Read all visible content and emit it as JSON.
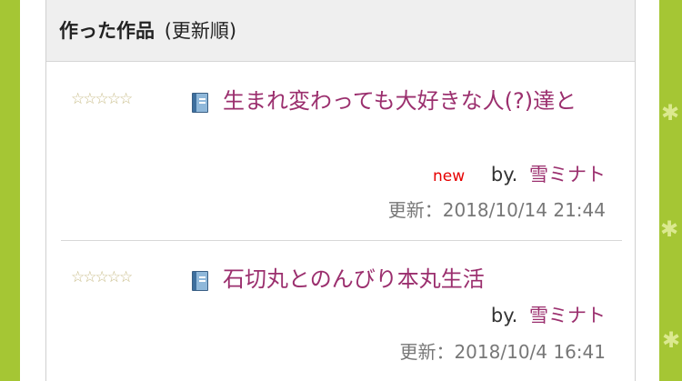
{
  "header": {
    "title": "作った作品",
    "subtitle": "(更新順)"
  },
  "works": [
    {
      "title": "生まれ変わっても大好きな人(?)達と",
      "stars": "☆☆☆☆☆",
      "rating_stars": 0,
      "new_label": "new",
      "by_label": "by.",
      "author": "雪ミナト",
      "updated": "更新：2018/10/14 21:44"
    },
    {
      "title": "石切丸とのんびり本丸生活",
      "stars": "☆☆☆☆☆",
      "rating_stars": 0,
      "by_label": "by.",
      "author": "雪ミナト",
      "updated": "更新：2018/10/4 16:41"
    }
  ],
  "icons": {
    "book": "book-icon",
    "star": "star-outline-icon",
    "flower": "flower-icon"
  },
  "colors": {
    "accent_green": "#a5c634",
    "link": "#9b2f6e",
    "new_badge": "#e60000"
  }
}
